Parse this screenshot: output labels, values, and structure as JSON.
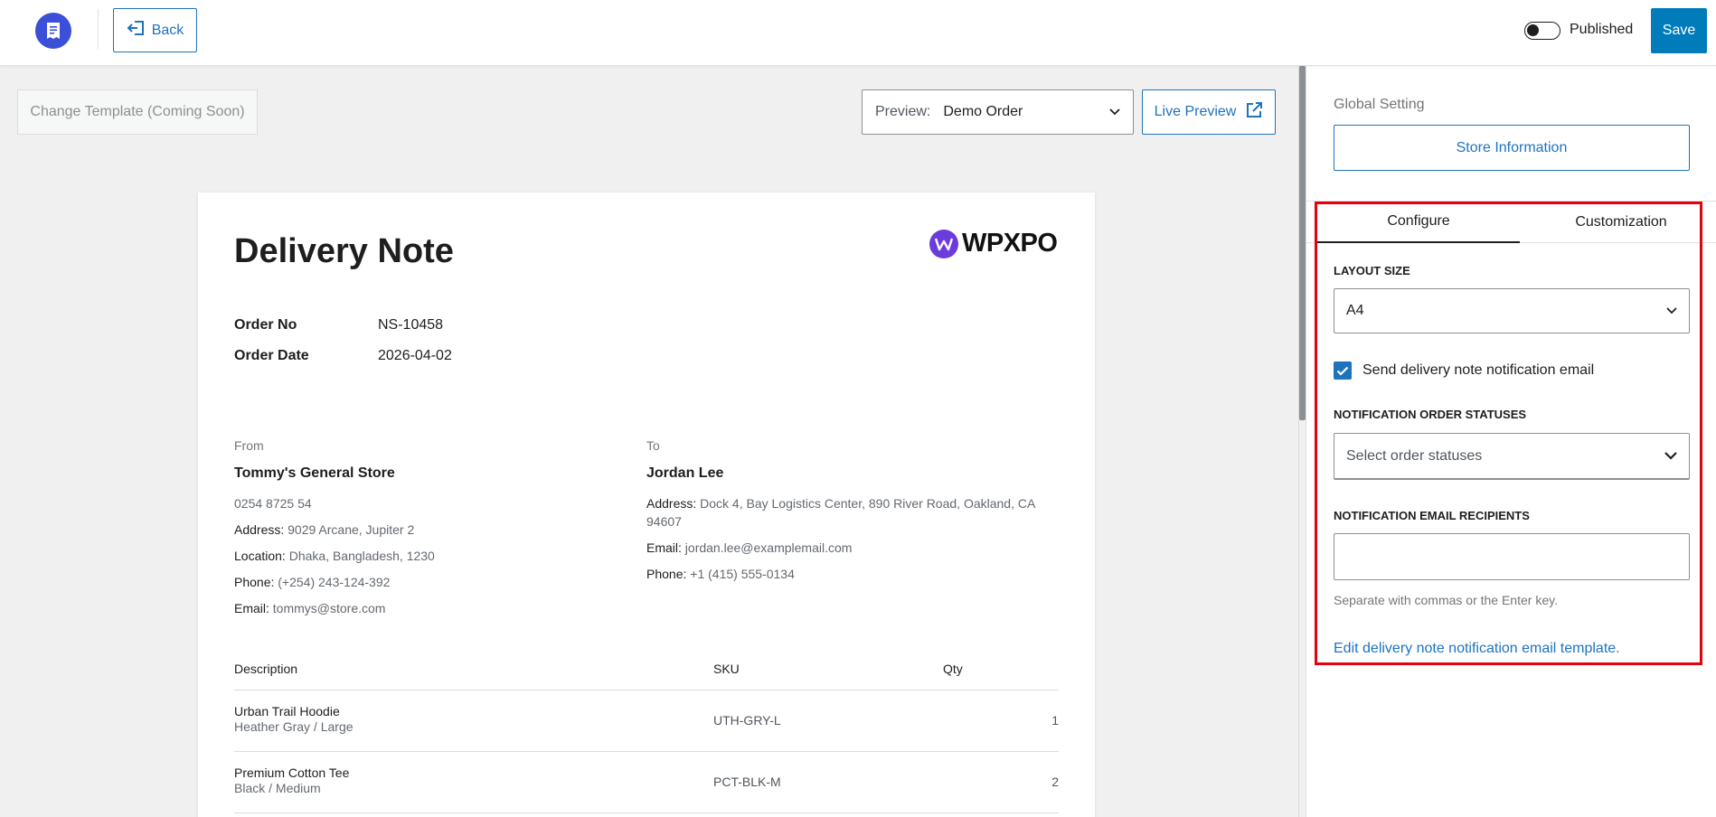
{
  "topbar": {
    "back_label": "Back",
    "published_label": "Published",
    "published_on": false,
    "save_label": "Save"
  },
  "canvas": {
    "change_template_label": "Change Template (Coming Soon)",
    "preview_label": "Preview:",
    "preview_value": "Demo Order",
    "live_preview_label": "Live Preview"
  },
  "document": {
    "title": "Delivery Note",
    "brand": "WPXPO",
    "meta": [
      {
        "key": "Order No",
        "value": "NS-10458"
      },
      {
        "key": "Order Date",
        "value": "2026-04-02"
      }
    ],
    "from": {
      "label": "From",
      "name": "Tommy's General Store",
      "phone_top": "0254 8725 54",
      "address_key": "Address:",
      "address": "9029 Arcane, Jupiter 2",
      "location_key": "Location:",
      "location": "Dhaka, Bangladesh, 1230",
      "phone_key": "Phone:",
      "phone": "(+254) 243-124-392",
      "email_key": "Email:",
      "email": "tommys@store.com"
    },
    "to": {
      "label": "To",
      "name": "Jordan Lee",
      "address_key": "Address:",
      "address": "Dock 4, Bay Logistics Center, 890 River Road, Oakland, CA 94607",
      "email_key": "Email:",
      "email": "jordan.lee@examplemail.com",
      "phone_key": "Phone:",
      "phone": "+1 (415) 555-0134"
    },
    "table": {
      "headers": [
        "Description",
        "SKU",
        "Qty"
      ],
      "rows": [
        {
          "name": "Urban Trail Hoodie",
          "variant": "Heather Gray / Large",
          "sku": "UTH-GRY-L",
          "qty": "1"
        },
        {
          "name": "Premium Cotton Tee",
          "variant": "Black / Medium",
          "sku": "PCT-BLK-M",
          "qty": "2"
        }
      ]
    }
  },
  "sidebar": {
    "global_setting_label": "Global Setting",
    "store_info_label": "Store Information",
    "tabs": [
      {
        "label": "Configure",
        "active": true
      },
      {
        "label": "Customization",
        "active": false
      }
    ],
    "layout_size_label": "LAYOUT SIZE",
    "layout_size_value": "A4",
    "send_email_label": "Send delivery note notification email",
    "send_email_checked": true,
    "statuses_label": "NOTIFICATION ORDER STATUSES",
    "statuses_placeholder": "Select order statuses",
    "recipients_label": "NOTIFICATION EMAIL RECIPIENTS",
    "recipients_value": "",
    "recipients_help": "Separate with commas or the Enter key.",
    "edit_template_link": "Edit delivery note notification email template."
  },
  "colors": {
    "accent": "#007cba",
    "link": "#1e73be",
    "logo_bg": "#3b4fd8",
    "highlight": "#e3000f"
  }
}
